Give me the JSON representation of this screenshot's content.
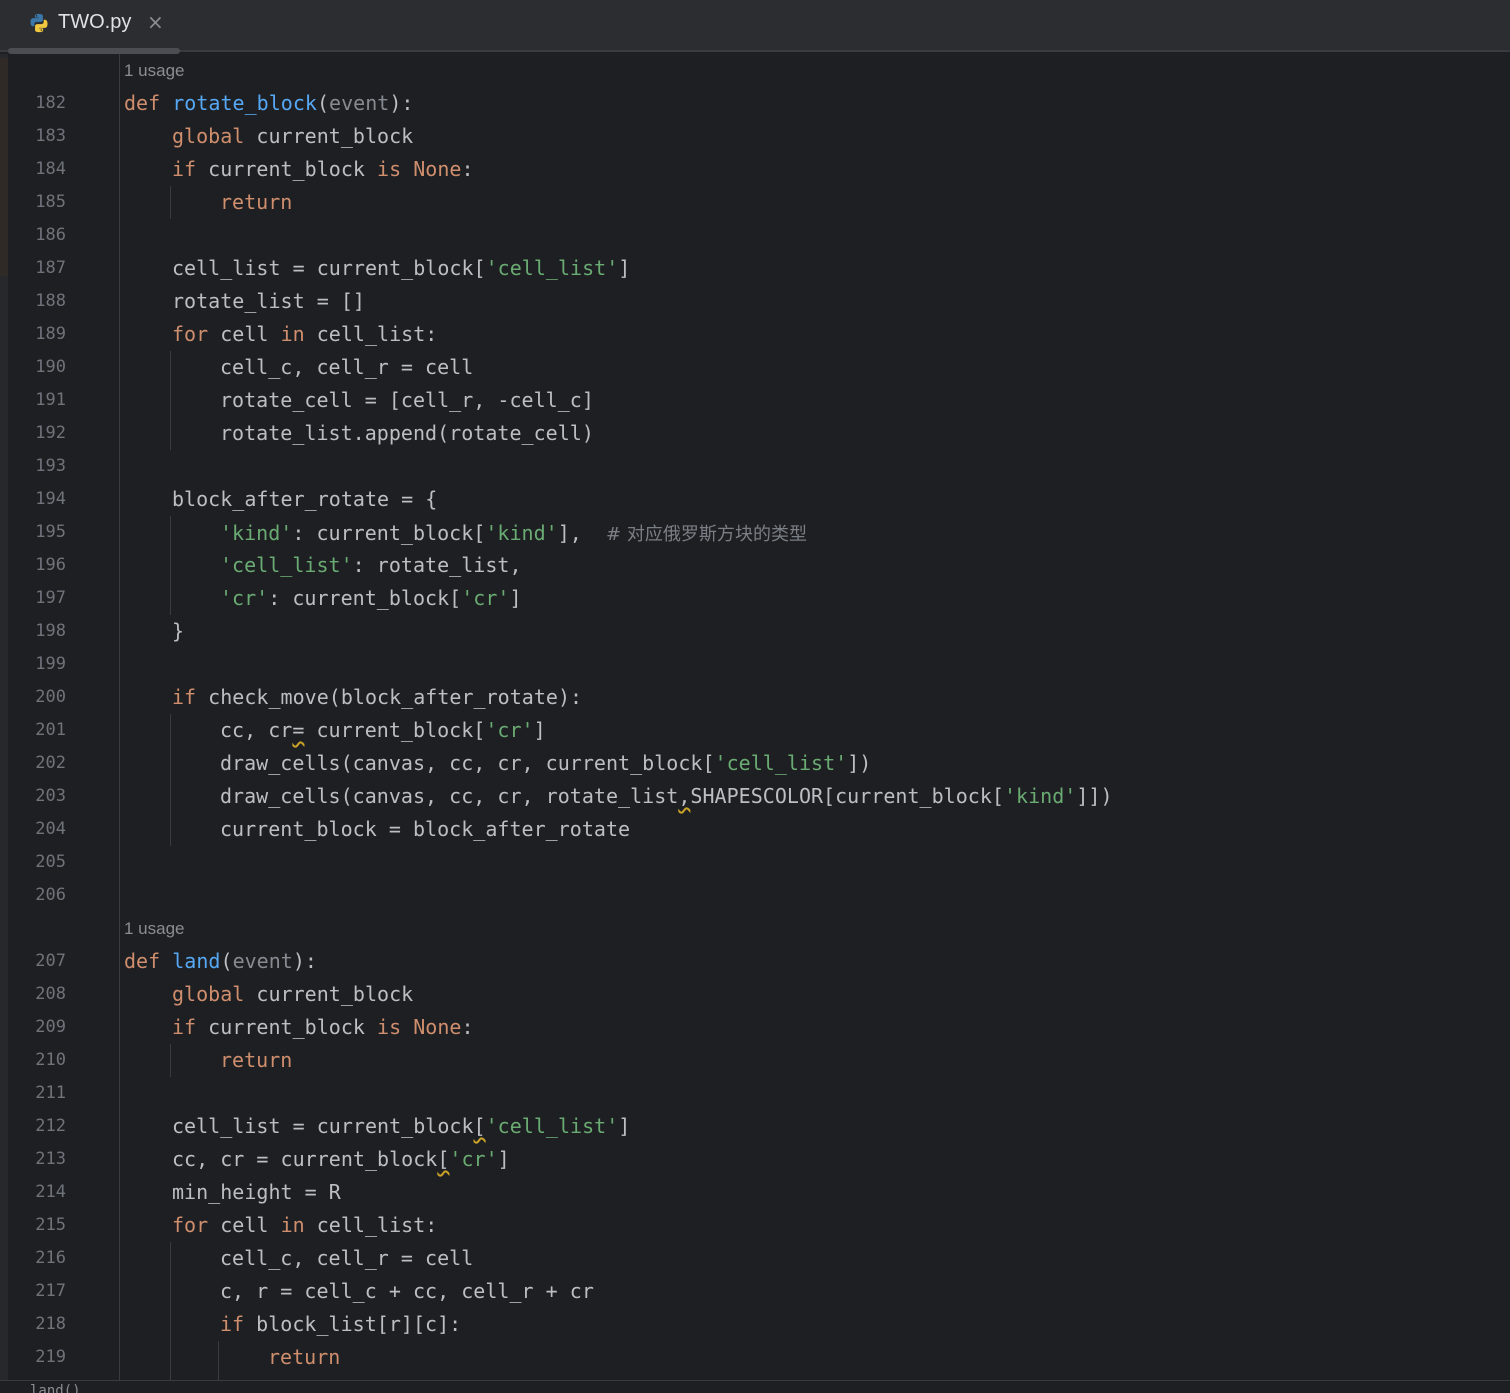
{
  "tab": {
    "filename": "TWO.py",
    "close_glyph": "×",
    "icon": "python-file-icon"
  },
  "editor": {
    "usage_label": "1 usage",
    "bottom_crumb": "land()",
    "lines": [
      {
        "n": "182"
      },
      {
        "n": "183"
      },
      {
        "n": "184"
      },
      {
        "n": "185"
      },
      {
        "n": "186"
      },
      {
        "n": "187"
      },
      {
        "n": "188"
      },
      {
        "n": "189"
      },
      {
        "n": "190"
      },
      {
        "n": "191"
      },
      {
        "n": "192"
      },
      {
        "n": "193"
      },
      {
        "n": "194"
      },
      {
        "n": "195"
      },
      {
        "n": "196"
      },
      {
        "n": "197"
      },
      {
        "n": "198"
      },
      {
        "n": "199"
      },
      {
        "n": "200"
      },
      {
        "n": "201"
      },
      {
        "n": "202"
      },
      {
        "n": "203"
      },
      {
        "n": "204"
      },
      {
        "n": "205"
      },
      {
        "n": "206"
      },
      {
        "n": "207"
      },
      {
        "n": "208"
      },
      {
        "n": "209"
      },
      {
        "n": "210"
      },
      {
        "n": "211"
      },
      {
        "n": "212"
      },
      {
        "n": "213"
      },
      {
        "n": "214"
      },
      {
        "n": "215"
      },
      {
        "n": "216"
      },
      {
        "n": "217"
      },
      {
        "n": "218"
      },
      {
        "n": "219"
      }
    ],
    "code": {
      "kw_def": "def",
      "kw_global": "global",
      "kw_if": "if",
      "kw_is": "is",
      "kw_none": "None",
      "kw_return": "return",
      "kw_for": "for",
      "kw_in": "in",
      "fn_rotate_block": "rotate_block",
      "fn_land": "land",
      "param_event": "event",
      "comment_195": "# 对应俄罗斯方块的类型",
      "s_cell_list": "'cell_list'",
      "s_kind": "'kind'",
      "s_cr": "'cr'"
    }
  },
  "colors": {
    "background": "#1e1f22",
    "keyword": "#cf8e6d",
    "function": "#56a8f5",
    "string": "#6aab73",
    "text": "#bcbec4"
  }
}
